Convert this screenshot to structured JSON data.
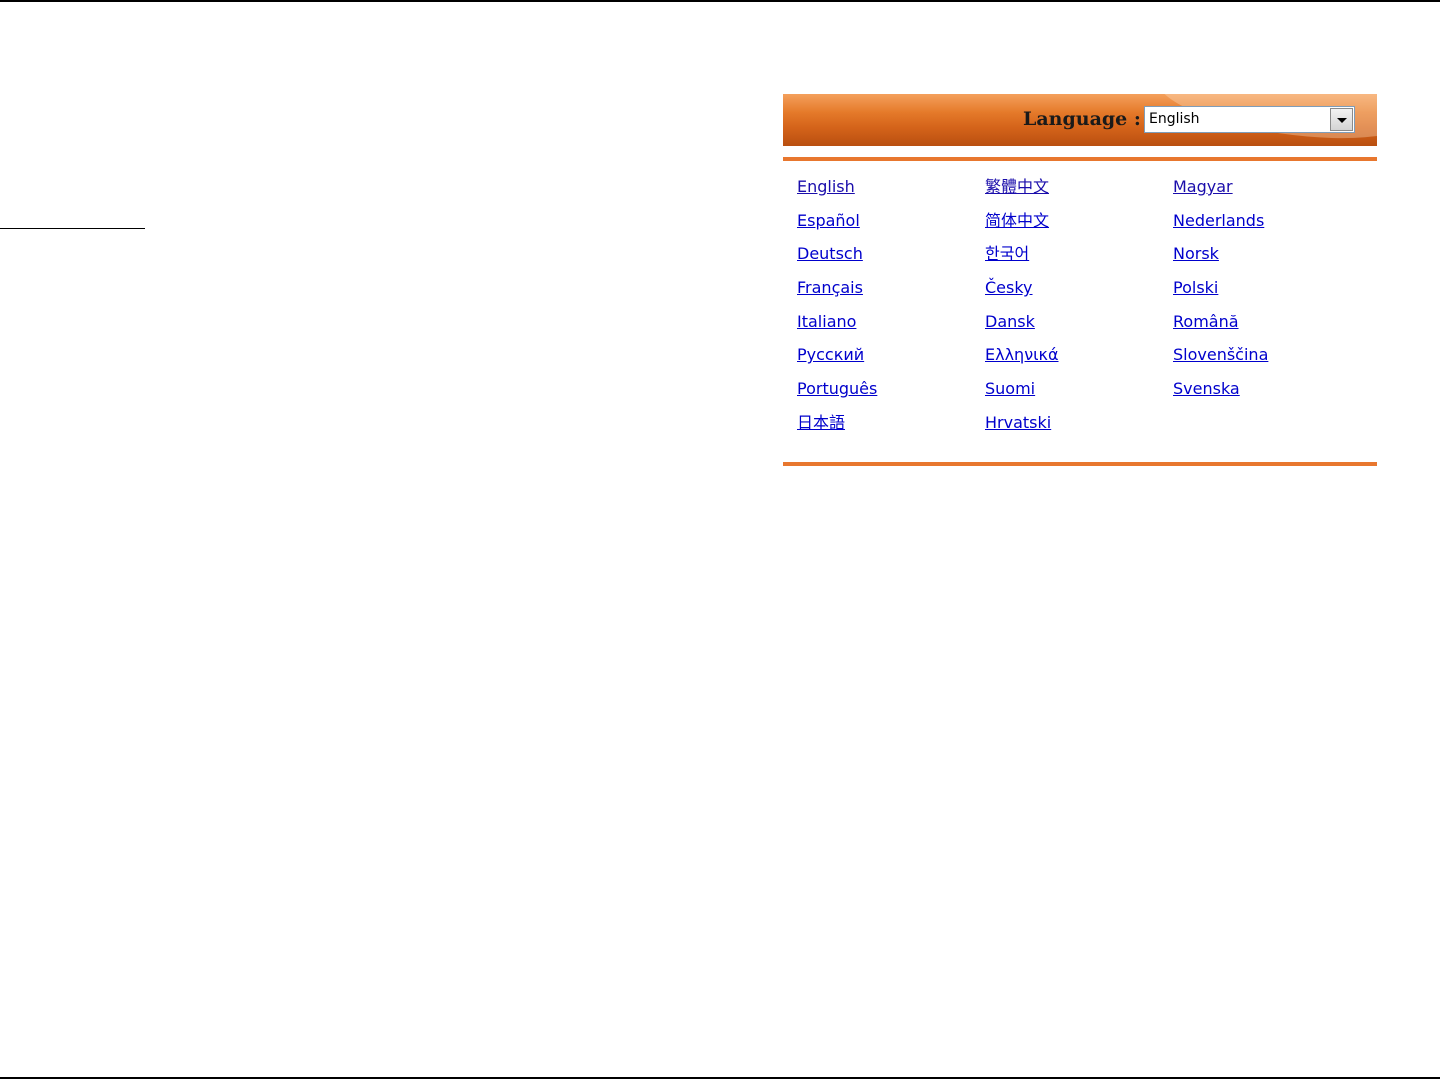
{
  "language_panel": {
    "label": "Language :",
    "selected": "English",
    "columns": [
      [
        "English",
        "Español",
        "Deutsch",
        "Français",
        "Italiano",
        "Русский",
        "Português",
        "日本語"
      ],
      [
        "繁體中文",
        "简体中文",
        "한국어",
        "Česky",
        "Dansk",
        "Ελληνικά",
        "Suomi",
        "Hrvatski"
      ],
      [
        "Magyar",
        "Nederlands",
        "Norsk",
        "Polski",
        "Română",
        "Slovenščina",
        "Svenska"
      ]
    ]
  },
  "colors": {
    "accent": "#e8772e",
    "link": "#0000cc"
  }
}
